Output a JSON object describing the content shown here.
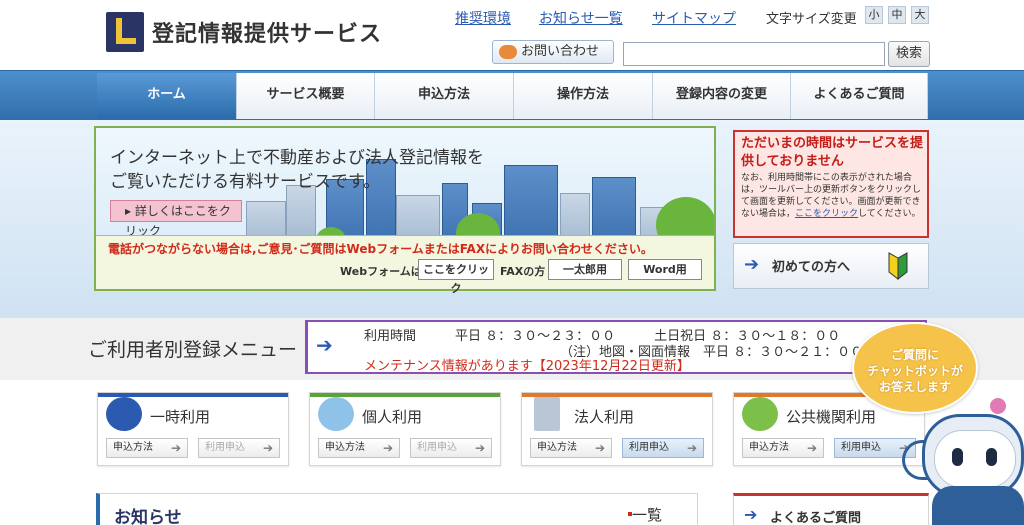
{
  "header": {
    "site_title": "登記情報提供サービス",
    "links": [
      "推奨環境",
      "お知らせ一覧",
      "サイトマップ"
    ],
    "font_size_label": "文字サイズ変更",
    "font_sizes": [
      "小",
      "中",
      "大"
    ],
    "contact_label": "お問い合わせ",
    "search_value": "",
    "search_button": "検索"
  },
  "nav": {
    "items": [
      "ホーム",
      "サービス概要",
      "申込方法",
      "操作方法",
      "登録内容の変更",
      "よくあるご質問"
    ],
    "active_index": 0
  },
  "banner": {
    "headline_1": "インターネット上で不動産および法人登記情報を",
    "headline_2": "ご覧いただける有料サービスです。",
    "detail_button": "詳しくはここをクリック",
    "note": "電話がつながらない場合は,ご意見･ご質問はWebフォームまたはFAXによりお問い合わせください。",
    "webform_label": "Webフォームは",
    "webform_button": "ここをクリック",
    "fax_label": "FAXの方",
    "ichitaro_button": "一太郎用",
    "word_button": "Word用"
  },
  "status": {
    "title": "ただいまの時間はサービスを提供しておりません",
    "body_1": "なお、利用時間帯にこの表示がされた場合は，ツールバー上の更新ボタンをクリックして画面を更新してください。",
    "body_2": "画面が更新できない場合は，",
    "link": "ここをクリック",
    "body_3": "してください。"
  },
  "first_time": {
    "label": "初めての方へ"
  },
  "registration": {
    "title": "ご利用者別登録メニュー",
    "hours_line_1": "利用時間　　　平日 ８：３０～２３：００　　　土日祝日 ８：３０～１８：００",
    "hours_line_2": "（注）地図・図面情報　平日 ８：３０～２１：００",
    "maintenance": "メンテナンス情報があります【2023年12月22日更新】"
  },
  "cards": [
    {
      "title": "一時利用",
      "icon": "time-icon",
      "color": "#2a5bb0",
      "btn1": "申込方法",
      "btn2": "利用申込",
      "btn2_active": false
    },
    {
      "title": "個人利用",
      "icon": "house-icon",
      "color": "#5aa33a",
      "btn1": "申込方法",
      "btn2": "利用申込",
      "btn2_active": false
    },
    {
      "title": "法人利用",
      "icon": "building-icon",
      "color": "#e07a2a",
      "btn1": "申込方法",
      "btn2": "利用申込",
      "btn2_active": true
    },
    {
      "title": "公共機関利用",
      "icon": "japan-map-icon",
      "color": "#e07a2a",
      "btn1": "申込方法",
      "btn2": "利用申込",
      "btn2_active": true
    }
  ],
  "news": {
    "title": "お知らせ",
    "more": "一覧"
  },
  "faq": {
    "label": "よくあるご質問"
  },
  "chatbot": {
    "line_1": "ご質問に",
    "line_2": "チャットボットが",
    "line_3": "お答えします"
  }
}
